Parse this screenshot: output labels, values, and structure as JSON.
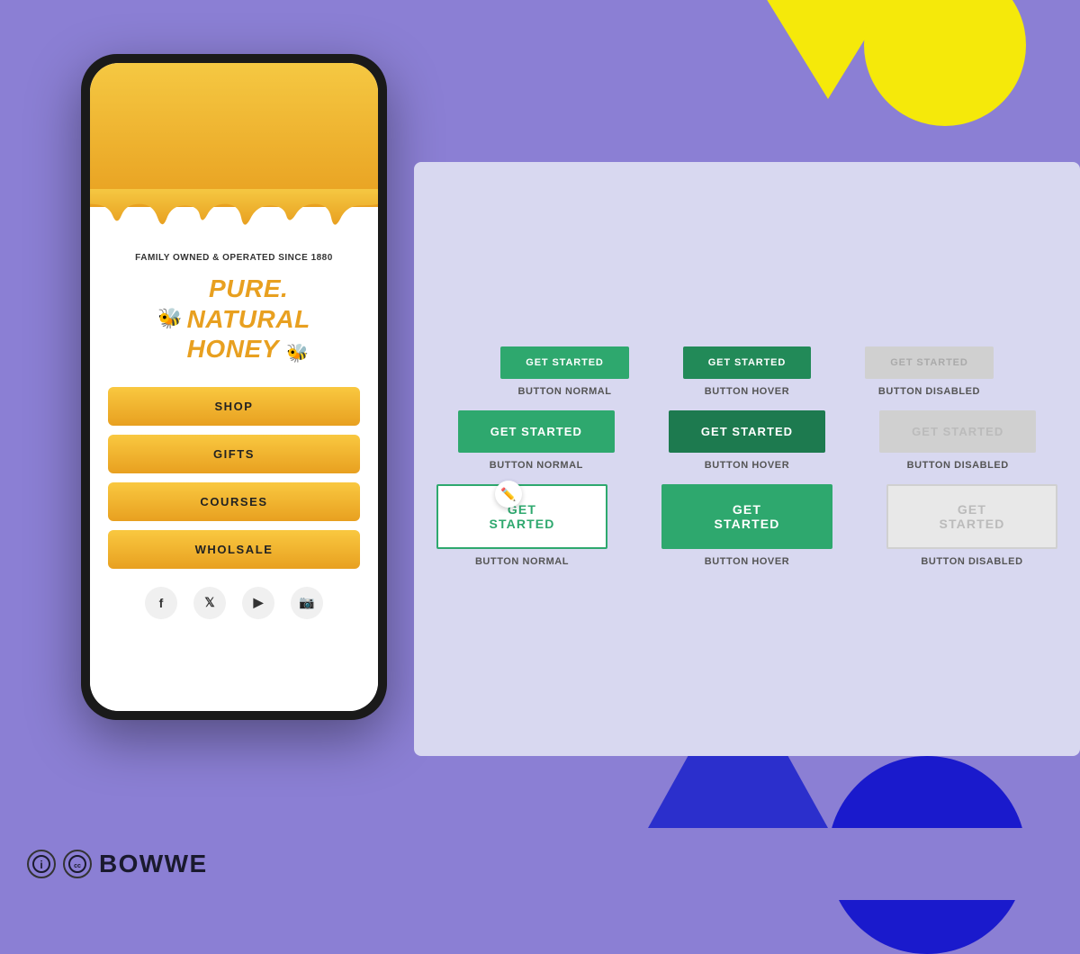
{
  "background": {
    "color": "#8b7fd4"
  },
  "phone": {
    "honey_header_text": "FAMILY OWNED &\nOPERATED SINCE 1880",
    "title_line1": "PURE.",
    "title_line2": "NATURAL",
    "title_line3": "HONEY",
    "buttons": [
      {
        "label": "SHOP"
      },
      {
        "label": "GIFTS"
      },
      {
        "label": "COURSES"
      },
      {
        "label": "WHOLSALE"
      }
    ],
    "social": [
      "f",
      "t",
      "▶",
      "📷"
    ]
  },
  "button_demo": {
    "rows": [
      {
        "buttons": [
          {
            "label": "GET STARTED",
            "state": "normal",
            "size": "sm",
            "desc": "BUTTON NORMAL"
          },
          {
            "label": "GET STARTED",
            "state": "hover",
            "size": "sm",
            "desc": "BUTTON HOVER"
          },
          {
            "label": "GET STARTED",
            "state": "disabled",
            "size": "sm",
            "desc": "BUTTON DISABLED"
          }
        ]
      },
      {
        "buttons": [
          {
            "label": "GET STARTED",
            "state": "normal",
            "size": "md",
            "desc": "BUTTON NORMAL"
          },
          {
            "label": "GET STARTED",
            "state": "hover",
            "size": "md",
            "desc": "BUTTON HOVER"
          },
          {
            "label": "GET STARTED",
            "state": "disabled",
            "size": "md",
            "desc": "BUTTON DISABLED"
          }
        ]
      },
      {
        "buttons": [
          {
            "label": "GET STARTED",
            "state": "normal",
            "size": "lg",
            "desc": "BUTTON NORMAL"
          },
          {
            "label": "GET STARTED",
            "state": "hover",
            "size": "lg",
            "desc": "BUTTON HOVER"
          },
          {
            "label": "GET STARTED",
            "state": "disabled",
            "size": "lg",
            "desc": "BUTTON DISABLED"
          }
        ]
      }
    ]
  },
  "logo": {
    "info_icon": "ℹ",
    "cc_icon": "cc",
    "brand_name": "BOWWE"
  }
}
